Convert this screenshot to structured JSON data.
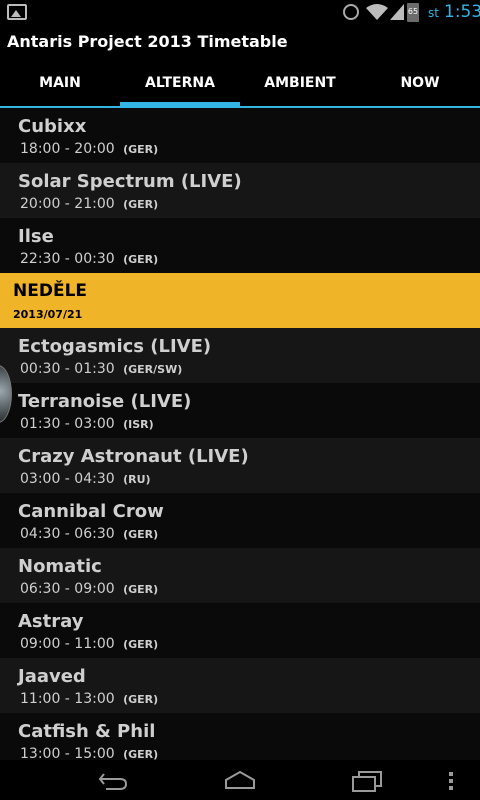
{
  "status_bar": {
    "day": "st",
    "clock": "1:53",
    "battery": "65",
    "icons": [
      "gallery-icon",
      "alarm-icon",
      "wifi-icon",
      "signal-icon",
      "battery-icon"
    ]
  },
  "app": {
    "title": "Antaris Project 2013 Timetable"
  },
  "tabs": [
    {
      "label": "MAIN"
    },
    {
      "label": "ALTERNA"
    },
    {
      "label": "AMBIENT"
    },
    {
      "label": "NOW"
    }
  ],
  "active_tab": "ALTERNA",
  "list": {
    "rows": [
      {
        "name": "Cubixx",
        "time": "18:00 - 20:00",
        "country": "(GER)"
      },
      {
        "name": "Solar Spectrum (LIVE)",
        "time": "20:00 - 21:00",
        "country": "(GER)"
      },
      {
        "name": "Ilse",
        "time": "22:30 - 00:30",
        "country": "(GER)"
      }
    ],
    "day_header": {
      "name": "NEDĚLE",
      "date": "2013/07/21"
    },
    "rows2": [
      {
        "name": "Ectogasmics (LIVE)",
        "time": "00:30 - 01:30",
        "country": "(GER/SW)"
      },
      {
        "name": "Terranoise (LIVE)",
        "time": "01:30 - 03:00",
        "country": "(ISR)"
      },
      {
        "name": "Crazy Astronaut (LIVE)",
        "time": "03:00 - 04:30",
        "country": "(RU)"
      },
      {
        "name": "Cannibal Crow",
        "time": "04:30 - 06:30",
        "country": "(GER)"
      },
      {
        "name": "Nomatic",
        "time": "06:30 - 09:00",
        "country": "(GER)"
      },
      {
        "name": "Astray",
        "time": "09:00 - 11:00",
        "country": "(GER)"
      },
      {
        "name": "Jaaved",
        "time": "11:00 - 13:00",
        "country": "(GER)"
      },
      {
        "name": "Catfish & Phil",
        "time": "13:00 - 15:00",
        "country": "(GER)"
      }
    ]
  },
  "colors": {
    "accent": "#33b5e5",
    "day_header_bg": "#f0b428"
  },
  "nav_bar": {
    "icons": [
      "back-icon",
      "home-icon",
      "recent-apps-icon",
      "menu-icon"
    ]
  }
}
